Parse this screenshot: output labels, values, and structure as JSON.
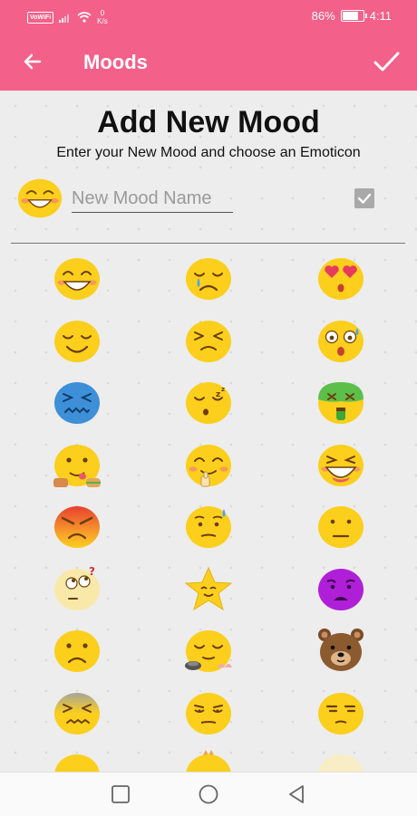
{
  "status_bar": {
    "volte_label": "VoWiFi",
    "net_speed_value": "0",
    "net_speed_unit": "K/s",
    "battery_percent": "86%",
    "battery_level": 0.86,
    "time": "4:11"
  },
  "app_bar": {
    "title": "Moods",
    "back_icon": "arrow-left-icon",
    "confirm_icon": "checkmark-icon"
  },
  "form": {
    "heading": "Add New Mood",
    "subheading": "Enter your New Mood and choose an Emoticon",
    "mood_name_value": "",
    "mood_name_placeholder": "New Mood Name",
    "checkbox_checked": true,
    "selected_emoticon": "laughing-blush"
  },
  "colors": {
    "accent": "#f36089",
    "emoji_yellow": "#fbcf1c",
    "background": "#ededed"
  },
  "emoticons": [
    "laughing-blush",
    "sad-tear",
    "heart-eyes",
    "smile-closed-eyes",
    "tired-squint",
    "scared-sweat",
    "cold-blue-grimace",
    "sleepy",
    "sick-green",
    "hungry-food",
    "smile-thumbs-up",
    "grinning-laugh",
    "angry-red",
    "anxious-sweat",
    "neutral-face",
    "confused-question",
    "star-face",
    "purple-sad",
    "frowning",
    "relaxed-spa",
    "teddy-bear",
    "frustrated-squint",
    "unamused-eyes",
    "annoyed-side-eye"
  ],
  "nav_bar": {
    "recents_icon": "square-recents-icon",
    "home_icon": "circle-home-icon",
    "back_icon": "triangle-back-icon"
  }
}
